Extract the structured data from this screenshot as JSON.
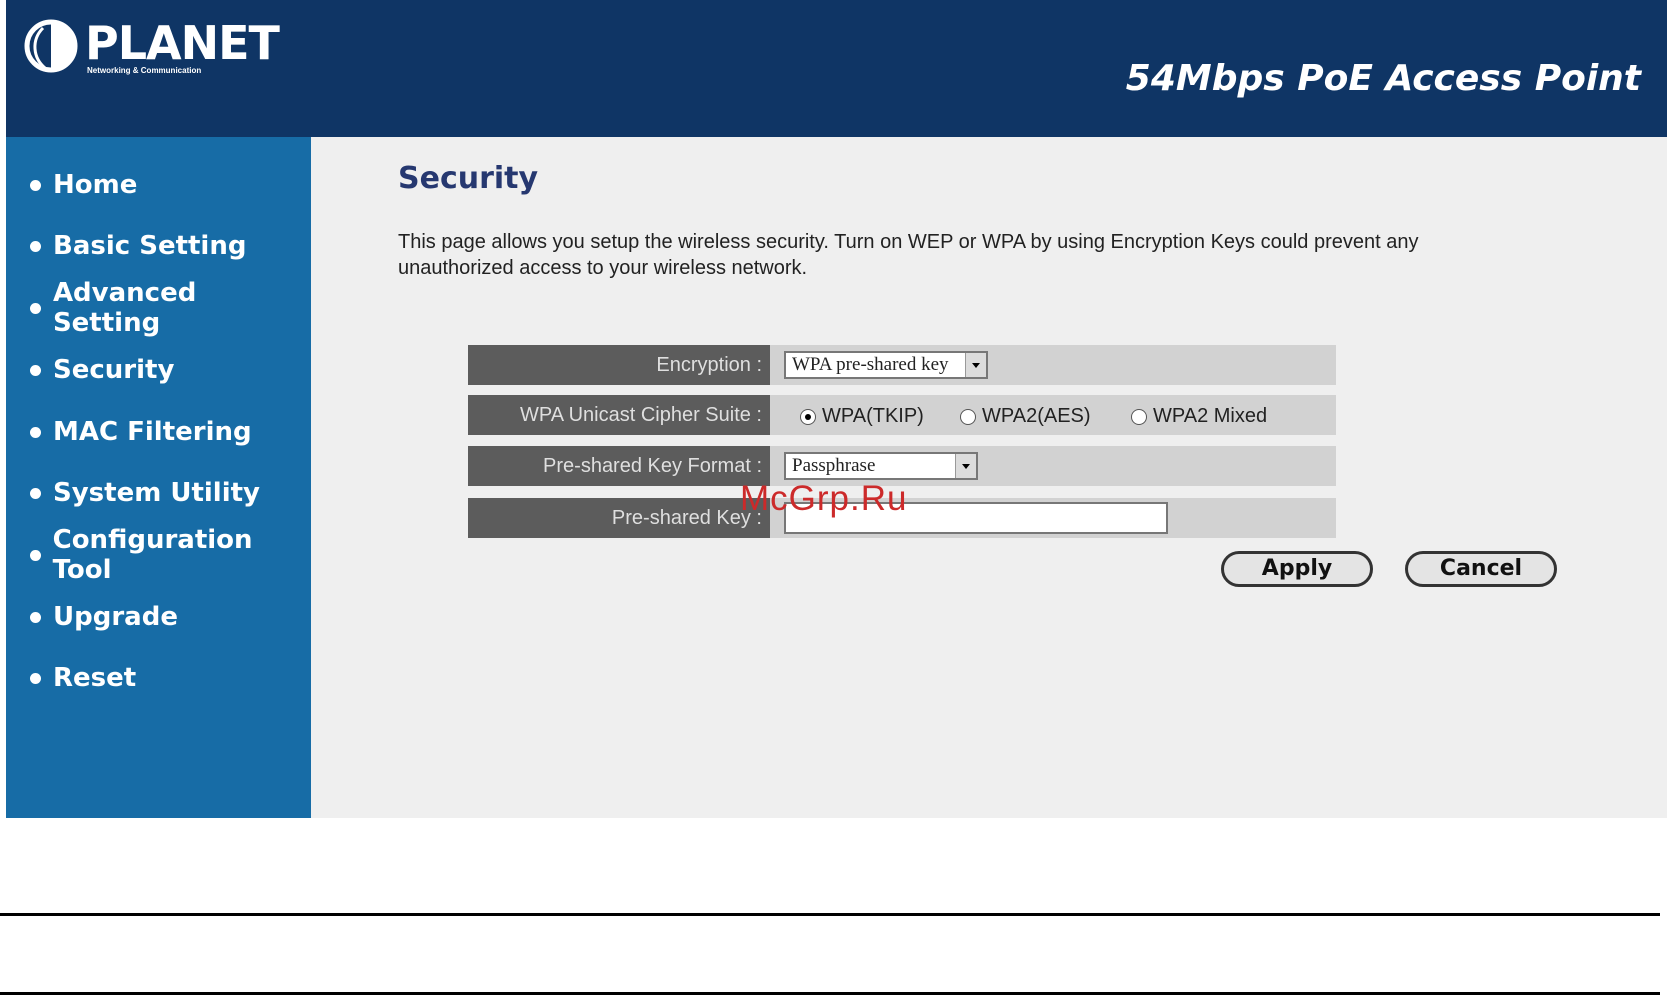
{
  "header": {
    "logo_text": "PLANET",
    "logo_tagline": "Networking & Communication",
    "product_title": "54Mbps PoE Access Point"
  },
  "sidebar": {
    "items": [
      {
        "label": "Home"
      },
      {
        "label": "Basic Setting"
      },
      {
        "label": "Advanced Setting"
      },
      {
        "label": "Security"
      },
      {
        "label": "MAC Filtering"
      },
      {
        "label": "System Utility"
      },
      {
        "label": "Configuration Tool"
      },
      {
        "label": "Upgrade"
      },
      {
        "label": "Reset"
      }
    ]
  },
  "main": {
    "title": "Security",
    "description": "This page allows you setup the wireless security. Turn on WEP or WPA by using Encryption Keys could prevent any unauthorized access to your wireless network."
  },
  "form": {
    "encryption": {
      "label": "Encryption :",
      "value": "WPA pre-shared key"
    },
    "cipher_suite": {
      "label": "WPA Unicast Cipher Suite :",
      "options": [
        {
          "label": "WPA(TKIP)",
          "selected": true
        },
        {
          "label": "WPA2(AES)",
          "selected": false
        },
        {
          "label": "WPA2 Mixed",
          "selected": false
        }
      ]
    },
    "key_format": {
      "label": "Pre-shared Key Format :",
      "value": "Passphrase"
    },
    "key": {
      "label": "Pre-shared Key :",
      "value": ""
    }
  },
  "buttons": {
    "apply": "Apply",
    "cancel": "Cancel"
  },
  "watermark": "McGrp.Ru",
  "colors": {
    "header_bg": "#0f3565",
    "sidebar_bg": "#176ca6",
    "content_bg": "#efefef",
    "title_color": "#263870",
    "watermark_color": "#cc2a2a"
  }
}
